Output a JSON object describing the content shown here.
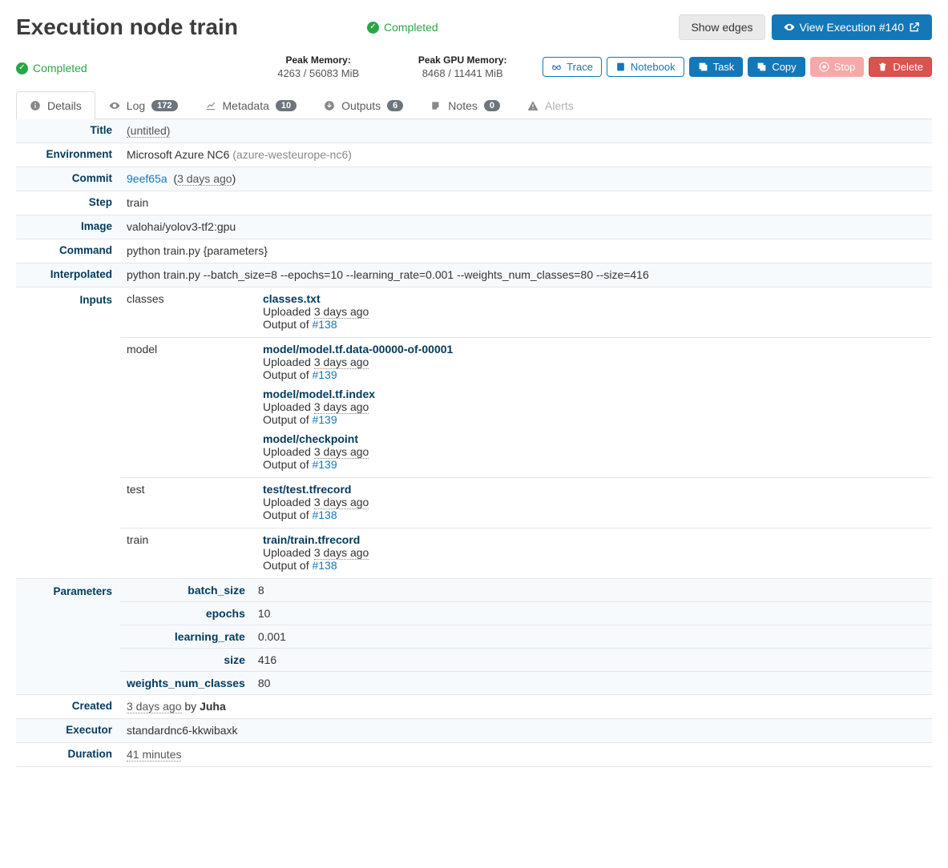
{
  "page_title": "Execution node train",
  "status": "Completed",
  "header_buttons": {
    "show_edges": "Show edges",
    "view_execution": "View Execution #140"
  },
  "sub_status": "Completed",
  "peak_memory_label": "Peak Memory:",
  "peak_memory_value": "4263 / 56083 MiB",
  "peak_gpu_label": "Peak GPU Memory:",
  "peak_gpu_value": "8468 / 11441 MiB",
  "action_buttons": {
    "trace": "Trace",
    "notebook": "Notebook",
    "task": "Task",
    "copy": "Copy",
    "stop": "Stop",
    "delete": "Delete"
  },
  "tabs": {
    "details": "Details",
    "log": "Log",
    "log_count": "172",
    "metadata": "Metadata",
    "metadata_count": "10",
    "outputs": "Outputs",
    "outputs_count": "6",
    "notes": "Notes",
    "notes_count": "0",
    "alerts": "Alerts"
  },
  "labels": {
    "title": "Title",
    "environment": "Environment",
    "commit": "Commit",
    "step": "Step",
    "image": "Image",
    "command": "Command",
    "interpolated": "Interpolated",
    "inputs": "Inputs",
    "parameters": "Parameters",
    "created": "Created",
    "executor": "Executor",
    "duration": "Duration"
  },
  "details": {
    "title": "(untitled)",
    "environment": "Microsoft Azure NC6",
    "environment_slug": "(azure-westeurope-nc6)",
    "commit_hash": "9eef65a",
    "commit_age": "3 days ago",
    "step": "train",
    "image": "valohai/yolov3-tf2:gpu",
    "command": "python train.py {parameters}",
    "interpolated": "python train.py --batch_size=8 --epochs=10 --learning_rate=0.001 --weights_num_classes=80 --size=416",
    "created_age": "3 days ago",
    "created_by_prefix": "by",
    "created_by": "Juha",
    "executor": "standardnc6-kkwibaxk",
    "duration": "41 minutes"
  },
  "inputs": [
    {
      "name": "classes",
      "files": [
        {
          "filename": "classes.txt",
          "uploaded_prefix": "Uploaded",
          "uploaded": "3 days ago",
          "output_of_prefix": "Output of",
          "output_of": "#138"
        }
      ]
    },
    {
      "name": "model",
      "files": [
        {
          "filename": "model/model.tf.data-00000-of-00001",
          "uploaded_prefix": "Uploaded",
          "uploaded": "3 days ago",
          "output_of_prefix": "Output of",
          "output_of": "#139"
        },
        {
          "filename": "model/model.tf.index",
          "uploaded_prefix": "Uploaded",
          "uploaded": "3 days ago",
          "output_of_prefix": "Output of",
          "output_of": "#139"
        },
        {
          "filename": "model/checkpoint",
          "uploaded_prefix": "Uploaded",
          "uploaded": "3 days ago",
          "output_of_prefix": "Output of",
          "output_of": "#139"
        }
      ]
    },
    {
      "name": "test",
      "files": [
        {
          "filename": "test/test.tfrecord",
          "uploaded_prefix": "Uploaded",
          "uploaded": "3 days ago",
          "output_of_prefix": "Output of",
          "output_of": "#138"
        }
      ]
    },
    {
      "name": "train",
      "files": [
        {
          "filename": "train/train.tfrecord",
          "uploaded_prefix": "Uploaded",
          "uploaded": "3 days ago",
          "output_of_prefix": "Output of",
          "output_of": "#138"
        }
      ]
    }
  ],
  "parameters": [
    {
      "key": "batch_size",
      "value": "8"
    },
    {
      "key": "epochs",
      "value": "10"
    },
    {
      "key": "learning_rate",
      "value": "0.001"
    },
    {
      "key": "size",
      "value": "416"
    },
    {
      "key": "weights_num_classes",
      "value": "80"
    }
  ]
}
